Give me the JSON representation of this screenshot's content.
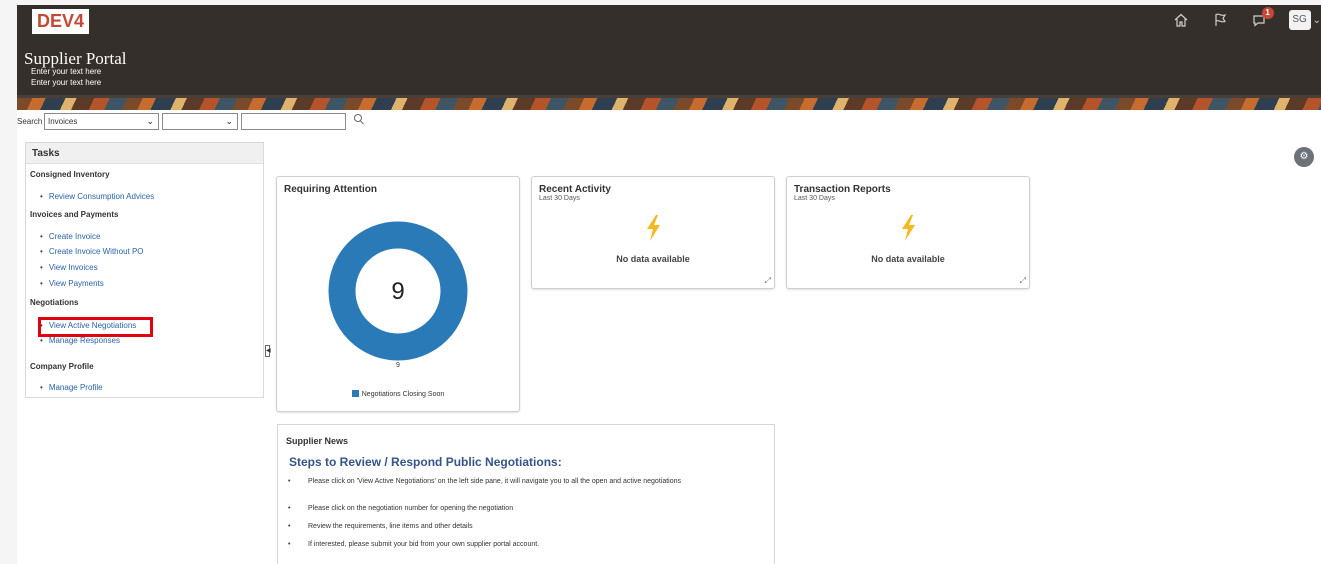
{
  "header": {
    "env_badge": "DEV4",
    "title": "Supplier Portal",
    "subtitle_1": "Enter your text here",
    "subtitle_2": "Enter your text here",
    "notification_count": "1",
    "user_initials": "SG",
    "icons": [
      "home-icon",
      "flag-icon",
      "notifications-icon",
      "chevron-down-icon"
    ]
  },
  "search": {
    "label": "Search",
    "scope_value": "Invoices",
    "attribute_value": "",
    "query_value": ""
  },
  "tasks": {
    "title": "Tasks",
    "sections": [
      {
        "heading": "Consigned Inventory",
        "links": [
          "Review Consumption Advices"
        ]
      },
      {
        "heading": "Invoices and Payments",
        "links": [
          "Create Invoice",
          "Create Invoice Without PO",
          "View Invoices",
          "View Payments"
        ]
      },
      {
        "heading": "Negotiations",
        "links": [
          "View Active Negotiations",
          "Manage Responses"
        ]
      },
      {
        "heading": "Company Profile",
        "links": [
          "Manage Profile"
        ]
      }
    ]
  },
  "requiring_attention": {
    "title": "Requiring Attention",
    "total": "9",
    "slice_value": "9",
    "legend": "Negotiations Closing Soon",
    "color": "#2a7ab8"
  },
  "recent_activity": {
    "title": "Recent Activity",
    "subtitle": "Last 30 Days",
    "empty": "No data available"
  },
  "transaction_reports": {
    "title": "Transaction Reports",
    "subtitle": "Last 30 Days",
    "empty": "No data available"
  },
  "supplier_news": {
    "title": "Supplier News",
    "heading": "Steps to Review / Respond Public Negotiations:",
    "items": [
      "Please click on 'View Active Negotiations' on the left side pane, it will navigate you to all the open and active negotiations",
      "Please click on the negotiation number for opening the negotiation",
      "Review the requirements, line items and other details",
      "If interested, please submit your bid from your own supplier portal account."
    ]
  },
  "colors": {
    "header_bg": "#342f2b",
    "brand_red": "#c74634",
    "link": "#2a63a8",
    "highlight": "#e3000f",
    "bolt": "#f5b820"
  }
}
